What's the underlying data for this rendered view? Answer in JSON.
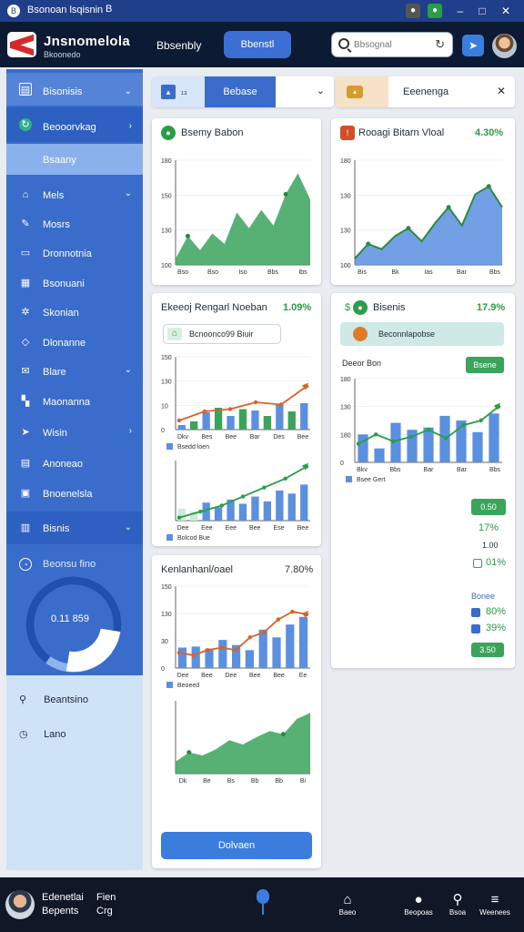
{
  "window": {
    "title": "Bsonoan lsqisnin",
    "badge": "B"
  },
  "header": {
    "brand": "Jnsnomelola",
    "brand_sub": "Bkoonedo",
    "nav_link": "Bbsenbly",
    "nav_button": "Bbenstl",
    "search": {
      "placeholder": "Bbsognal"
    }
  },
  "filterbar": {
    "tab1_label": "Bebase",
    "tab2_label": "Eeenenga"
  },
  "sidebar": {
    "items": [
      {
        "label": "Bisonisis",
        "icon": "layers-icon"
      },
      {
        "label": "Beooorvkag",
        "icon": "refresh-icon"
      },
      {
        "label": "Bsaany",
        "icon": "none"
      },
      {
        "label": "Mels",
        "icon": "home-icon"
      },
      {
        "label": "Mosrs",
        "icon": "pen-icon"
      },
      {
        "label": "Dronnotnia",
        "icon": "image-icon"
      },
      {
        "label": "Bsonuani",
        "icon": "grid-icon"
      },
      {
        "label": "Skonian",
        "icon": "gear-icon"
      },
      {
        "label": "Dlonanne",
        "icon": "diamond-icon"
      },
      {
        "label": "Blare",
        "icon": "mail-icon"
      },
      {
        "label": "Maonanna",
        "icon": "grid-icon"
      },
      {
        "label": "Wisin",
        "icon": "arrow-icon"
      },
      {
        "label": "Anoneao",
        "icon": "doc-icon"
      },
      {
        "label": "Bnoenelsla",
        "icon": "calendar-icon"
      },
      {
        "label": "Bisnis",
        "icon": "chart-icon"
      }
    ],
    "gauge_title": "Beonsu fino",
    "gauge_value": "0.11 859",
    "gauge_fraction": 0.75,
    "bottom_items": [
      "Beantsino",
      "Lano"
    ]
  },
  "cards": {
    "c1": {
      "title": "Bsemy Babon",
      "ticks": [
        "Bso",
        "Bso",
        "Iso",
        "Bbs",
        "Ibs"
      ],
      "y": [
        "180",
        "150",
        "130",
        "100"
      ],
      "chart_data": {
        "type": "area",
        "values": [
          12,
          55,
          28,
          60,
          40,
          100,
          70,
          105,
          75,
          135,
          175,
          125
        ],
        "ylim": [
          0,
          200
        ]
      }
    },
    "c2": {
      "title": "Rooagi Bitarn Vloal",
      "value": "4.30%",
      "ticks": [
        "Bis",
        "Bk",
        "Ias",
        "Bar",
        "Bbs"
      ],
      "y": [
        "180",
        "130",
        "130",
        "100"
      ],
      "chart_data": {
        "type": "area",
        "values": [
          12,
          40,
          30,
          55,
          70,
          45,
          80,
          110,
          75,
          135,
          150,
          110
        ],
        "ylim": [
          0,
          200
        ]
      }
    },
    "c3": {
      "title": "Ekeeoj Rengarl Noeban",
      "value": "1.09%",
      "chip": "Bcnoonco99 Biuir",
      "y": [
        "150",
        "130",
        "10",
        "0"
      ],
      "ticks": [
        "Dkv",
        "Bes",
        "Bee",
        "Bar",
        "Des",
        "Bee"
      ],
      "legend": "Bsedd loen",
      "chart_data": {
        "type": "bar",
        "values": [
          10,
          18,
          38,
          48,
          30,
          45,
          42,
          30,
          55,
          40,
          58
        ],
        "line": [
          20,
          40,
          45,
          60,
          55,
          95
        ],
        "ylim": [
          0,
          160
        ]
      }
    },
    "c3b": {
      "ticks": [
        "Dee",
        "Eee",
        "Eee",
        "Bee",
        "Ese",
        "Bee"
      ],
      "legend": "Bolcod Bue",
      "chart_data": {
        "type": "bar",
        "values": [
          20,
          15,
          30,
          22,
          35,
          28,
          40,
          32,
          50,
          45,
          60
        ],
        "line": [
          5,
          15,
          25,
          40,
          55,
          70,
          90
        ],
        "ylim": [
          0,
          100
        ]
      }
    },
    "c4": {
      "title": "Bisenis",
      "value": "17.9%",
      "chip": "Beconnlapobse",
      "lbl": "Deeor Bon",
      "pill": "Bsene",
      "y": [
        "180",
        "130",
        "180",
        "0"
      ],
      "ticks": [
        "Bkv",
        "Bbs",
        "Bar",
        "Bar",
        "Bbs"
      ],
      "legend": "Bsee Gert",
      "chart_data": {
        "type": "bar",
        "values": [
          60,
          30,
          85,
          70,
          75,
          100,
          90,
          65,
          105
        ],
        "line": [
          40,
          60,
          45,
          55,
          70,
          52,
          80,
          90,
          120
        ],
        "ylim": [
          0,
          180
        ]
      },
      "stats": [
        {
          "v": "0.50"
        },
        {
          "v": "17%"
        },
        {
          "v": "1.00"
        },
        {
          "v": "01%"
        },
        {
          "v": "Bonee"
        },
        {
          "v": "80%"
        },
        {
          "v": "39%"
        },
        {
          "v": "3.50"
        }
      ]
    },
    "c5": {
      "title": "Kenlanhanl/oael",
      "value": "7.80%",
      "y": [
        "150",
        "130",
        "30",
        "0"
      ],
      "ticks": [
        "Dee",
        "Bee",
        "Dee",
        "Bee",
        "Bee",
        "Ee"
      ],
      "legend": "Beoeed",
      "chart_data": {
        "type": "bar",
        "values": [
          40,
          42,
          38,
          55,
          45,
          35,
          75,
          60,
          85,
          100
        ],
        "line": [
          30,
          25,
          35,
          40,
          35,
          60,
          70,
          95,
          110,
          105
        ],
        "ylim": [
          0,
          160
        ]
      }
    },
    "c5b": {
      "ticks": [
        "Dk",
        "Be",
        "Bs",
        "Bb",
        "Bb",
        "Bi"
      ],
      "chart_data": {
        "type": "area",
        "values": [
          20,
          35,
          30,
          40,
          55,
          48,
          60,
          70,
          65,
          90,
          100
        ],
        "ylim": [
          0,
          120
        ]
      },
      "button": "Dolvaen"
    }
  },
  "user": {
    "name": "Edenetlai",
    "role": "Bepents",
    "action1": "Fien",
    "action2": "Crg"
  },
  "bottomnav": [
    "Baeo",
    "Beopoas",
    "Bsoa",
    "Weenees"
  ],
  "colors": {
    "accent": "#3a6ccc",
    "green": "#3aa35c",
    "dark": "#0d1a33"
  }
}
